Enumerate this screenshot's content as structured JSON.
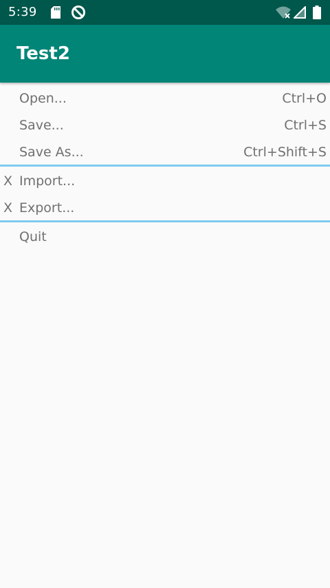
{
  "status_bar": {
    "time": "5:39",
    "icons": [
      "sd-card-icon",
      "data-saver-icon",
      "wifi-off-icon",
      "signal-icon",
      "battery-icon"
    ]
  },
  "app_bar": {
    "title": "Test2",
    "color": "#008577"
  },
  "menu": {
    "groups": [
      {
        "items": [
          {
            "mark": "",
            "label": "Open...",
            "shortcut": "Ctrl+O"
          },
          {
            "mark": "",
            "label": "Save...",
            "shortcut": "Ctrl+S"
          },
          {
            "mark": "",
            "label": "Save As...",
            "shortcut": "Ctrl+Shift+S"
          }
        ]
      },
      {
        "items": [
          {
            "mark": "X",
            "label": "Import...",
            "shortcut": ""
          },
          {
            "mark": "X",
            "label": "Export...",
            "shortcut": ""
          }
        ]
      },
      {
        "items": [
          {
            "mark": "",
            "label": "Quit",
            "shortcut": ""
          }
        ]
      }
    ],
    "divider_color": "#7ecbf0"
  }
}
